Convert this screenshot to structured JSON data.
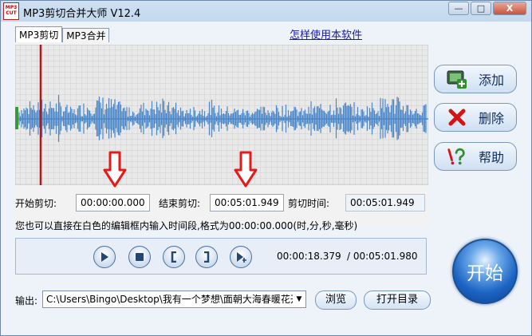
{
  "window": {
    "title": "MP3剪切合并大师 V12.4",
    "icon_text": "MP3 CUT",
    "controls": {
      "minimize": "—",
      "maximize": "□",
      "close": "X"
    }
  },
  "tabs": [
    {
      "label": "MP3剪切",
      "active": true
    },
    {
      "label": "MP3合并",
      "active": false
    }
  ],
  "help_link": "怎样使用本软件",
  "side_buttons": [
    {
      "label": "添加",
      "icon": "add-film-icon"
    },
    {
      "label": "删除",
      "icon": "red-x-icon"
    },
    {
      "label": "帮助",
      "icon": "help-question-icon"
    }
  ],
  "fields": {
    "start_label": "开始剪切:",
    "start_value": "00:00:00.000",
    "end_label": "结束剪切:",
    "end_value": "00:05:01.949",
    "duration_label": "剪切时间:",
    "duration_value": "00:05:01.949"
  },
  "hint": "您也可以直接在白色的编辑框内输入时间段,格式为00:00:00.000(时,分,秒,毫秒)",
  "player": {
    "current_time": "00:00:18.379",
    "total_time": "/ 00:05:01.980",
    "buttons": [
      "play-icon",
      "stop-icon",
      "mark-start-icon",
      "mark-end-icon",
      "play-selection-icon"
    ]
  },
  "start_button": "开始",
  "output": {
    "label": "输出:",
    "path": "C:\\Users\\Bingo\\Desktop\\我有一个梦想\\面朝大海春暖花开",
    "browse": "浏览",
    "open_dir": "打开目录"
  },
  "colors": {
    "waveform": "#4a86c8",
    "cursor": "#b01818",
    "annotation_arrow": "#e21b1b",
    "start_button": "#1d64c4"
  }
}
